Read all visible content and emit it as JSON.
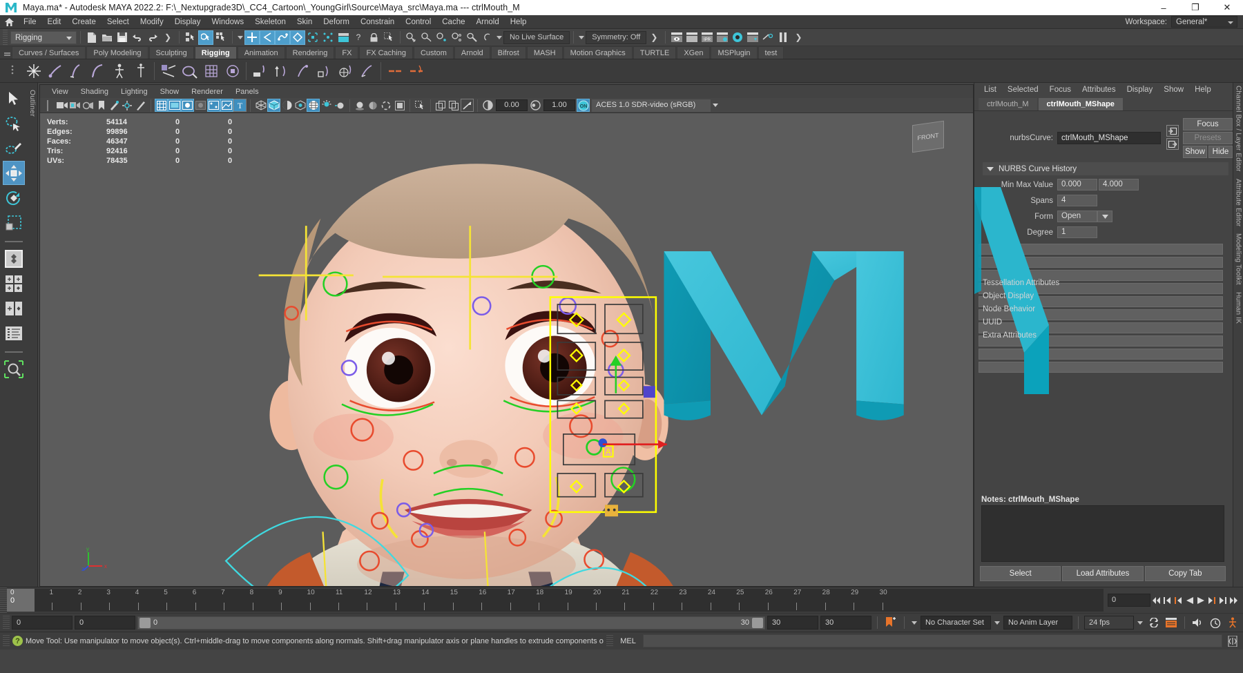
{
  "titlebar": {
    "title": "Maya.ma* - Autodesk MAYA 2022.2: F:\\_Nextupgrade3D\\_CC4_Cartoon\\_YoungGirl\\Source\\Maya_src\\Maya.ma   ---   ctrlMouth_M",
    "minimize": "–",
    "maximize": "❐",
    "close": "✕"
  },
  "menubar": {
    "items": [
      "File",
      "Edit",
      "Create",
      "Select",
      "Modify",
      "Display",
      "Windows",
      "Skeleton",
      "Skin",
      "Deform",
      "Constrain",
      "Control",
      "Cache",
      "Arnold",
      "Help"
    ],
    "workspace_label": "Workspace:",
    "workspace_value": "General*"
  },
  "toolbar": {
    "menuset": "Rigging",
    "live_surface": "No Live Surface",
    "symmetry": "Symmetry: Off"
  },
  "shelf": {
    "tabs": [
      "Curves / Surfaces",
      "Poly Modeling",
      "Sculpting",
      "Rigging",
      "Animation",
      "Rendering",
      "FX",
      "FX Caching",
      "Custom",
      "Arnold",
      "Bifrost",
      "MASH",
      "Motion Graphics",
      "TURTLE",
      "XGen",
      "MSPlugin",
      "test"
    ],
    "active_tab": "Rigging"
  },
  "toolbox": {
    "items": [
      "select-tool",
      "lasso-tool",
      "paint-select-tool",
      "move-tool",
      "rotate-tool",
      "scale-tool",
      "last-tool",
      "snap-grid",
      "snap-curve",
      "snap-point",
      "show-manip",
      "outliner-search"
    ],
    "active": "move-tool"
  },
  "outliner_strip_label": "Outliner",
  "viewport": {
    "panel_menu": [
      "View",
      "Shading",
      "Lighting",
      "Show",
      "Renderer",
      "Panels"
    ],
    "exposure": "0.00",
    "gamma": "1.00",
    "color_management_toggle": "ON",
    "color_space": "ACES 1.0 SDR-video (sRGB)",
    "viewcube_label": "FRONT",
    "hud": {
      "rows": [
        {
          "label": "Verts:",
          "total": "54114",
          "v2": "0",
          "v3": "0"
        },
        {
          "label": "Edges:",
          "total": "99896",
          "v2": "0",
          "v3": "0"
        },
        {
          "label": "Faces:",
          "total": "46347",
          "v2": "0",
          "v3": "0"
        },
        {
          "label": "Tris:",
          "total": "92416",
          "v2": "0",
          "v3": "0"
        },
        {
          "label": "UVs:",
          "total": "78435",
          "v2": "0",
          "v3": "0"
        }
      ]
    },
    "axis_labels": {
      "y": "y",
      "x": "x",
      "z": "z"
    }
  },
  "attribute_editor": {
    "menu": [
      "List",
      "Selected",
      "Focus",
      "Attributes",
      "Display",
      "Show",
      "Help"
    ],
    "tabs": [
      {
        "label": "ctrlMouth_M",
        "active": false
      },
      {
        "label": "ctrlMouth_MShape",
        "active": true
      }
    ],
    "node_type_label": "nurbsCurve:",
    "node_name": "ctrlMouth_MShape",
    "focus_btn": "Focus",
    "presets_btn": "Presets",
    "show_btn": "Show",
    "hide_btn": "Hide",
    "section_title": "NURBS Curve History",
    "fields": [
      {
        "label": "Min Max Value",
        "value": "0.000",
        "value2": "4.000"
      },
      {
        "label": "Spans",
        "value": "4"
      },
      {
        "label": "Form",
        "value": "Open"
      },
      {
        "label": "Degree",
        "value": "1"
      }
    ],
    "collapsed_sections": [
      "Tessellation Attributes",
      "Object Display",
      "Node Behavior",
      "UUID",
      "Extra Attributes"
    ],
    "notes_label": "Notes:",
    "notes_target": "ctrlMouth_MShape",
    "buttons": [
      "Select",
      "Load Attributes",
      "Copy Tab"
    ]
  },
  "dock_tabs": [
    "Channel Box / Layer Editor",
    "Attribute Editor",
    "Modeling Toolkit",
    "Human IK"
  ],
  "timeline": {
    "ticks": [
      "1",
      "2",
      "3",
      "4",
      "5",
      "6",
      "7",
      "8",
      "9",
      "10",
      "11",
      "12",
      "13",
      "14",
      "15",
      "16",
      "17",
      "18",
      "19",
      "20",
      "21",
      "22",
      "23",
      "24",
      "25",
      "26",
      "27",
      "28",
      "29",
      "30"
    ],
    "current_frame_top": "0",
    "current_frame_bottom": "0",
    "frame_field": "0"
  },
  "rangebar": {
    "range_start": "0",
    "range_end": "0",
    "slider_left_value": "0",
    "slider_right_value": "30",
    "anim_end": "30",
    "playback_end": "30",
    "character_set": "No Character Set",
    "anim_layer": "No Anim Layer",
    "fps": "24 fps"
  },
  "statusline": {
    "help_icon": "?",
    "help_text": "Move Tool: Use manipulator to move object(s). Ctrl+middle-drag to move components along normals. Shift+drag manipulator axis or plane handles to extrude components or c",
    "mel_label": "MEL",
    "command_value": ""
  },
  "colors": {
    "accent_blue": "#4e9ecb",
    "maya_teal": "#3ec5d8",
    "select_yellow": "#ffff00",
    "status_green": "#9dc24b",
    "axis_red": "#e03030",
    "axis_green": "#30c030",
    "title_bg": "#ffffff"
  }
}
